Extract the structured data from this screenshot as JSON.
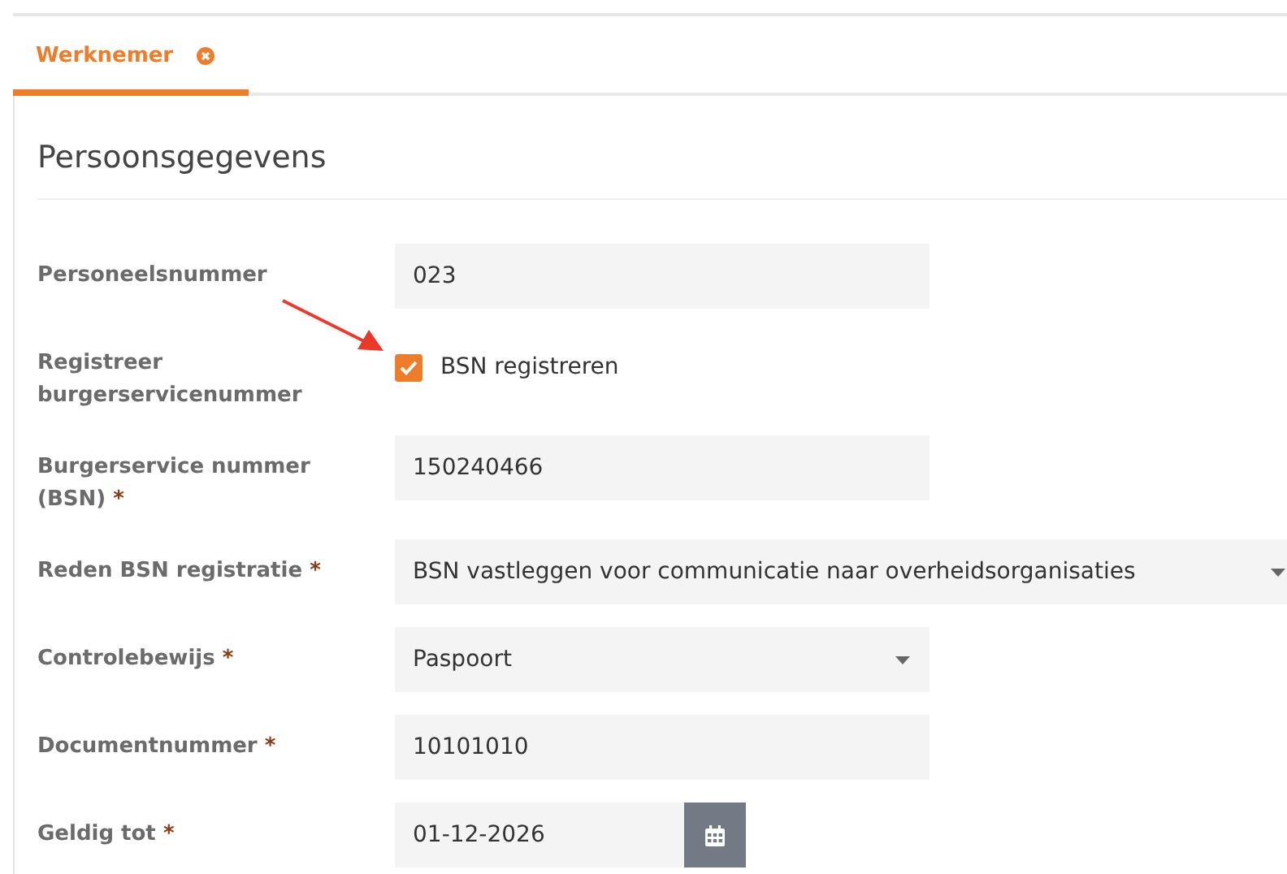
{
  "tabs": [
    {
      "label": "Werknemer",
      "selected": true
    }
  ],
  "section": {
    "title": "Persoonsgegevens"
  },
  "fields": [
    {
      "kind": "text",
      "label": "Personeelsnummer",
      "value": "023"
    },
    {
      "kind": "checkbox",
      "label": "Registreer burgerservicenummer",
      "option": "BSN registreren",
      "checked": true
    },
    {
      "kind": "text",
      "label": "Burgerservice nummer (BSN)",
      "required_mark": "*",
      "value": "150240466"
    },
    {
      "kind": "select",
      "label": "Reden BSN registratie",
      "required_mark": "*",
      "value": "BSN vastleggen voor communicatie naar overheidsorganisaties",
      "wide": true
    },
    {
      "kind": "select",
      "label": "Controlebewijs",
      "required_mark": "*",
      "value": "Paspoort"
    },
    {
      "kind": "text",
      "label": "Documentnummer",
      "required_mark": "*",
      "value": "10101010"
    },
    {
      "kind": "date",
      "label": "Geldig tot",
      "required_mark": "*",
      "value": "01-12-2026"
    }
  ]
}
